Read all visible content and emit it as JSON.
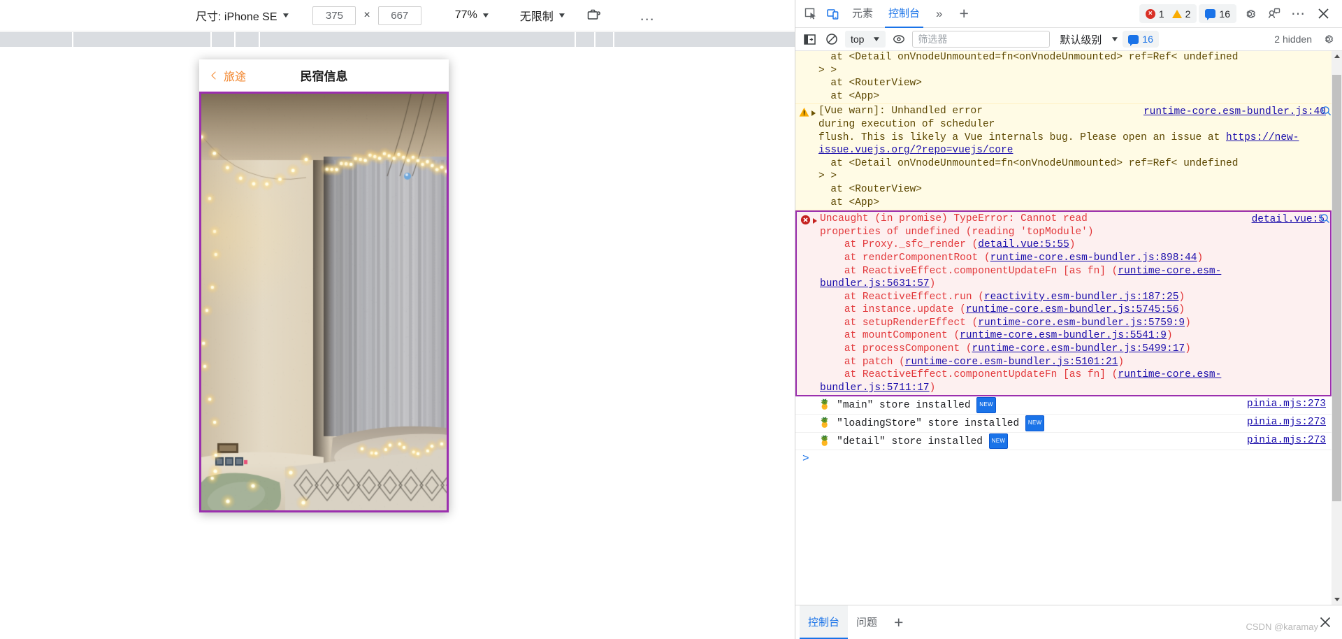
{
  "device_toolbar": {
    "size_label": "尺寸: iPhone SE",
    "width_value": "375",
    "times": "×",
    "height_value": "667",
    "zoom_label": "77%",
    "throttle_label": "无限制",
    "screenshot_icon": "camera-rotate-icon",
    "more_options": "…"
  },
  "mobile_app": {
    "back_label": "旅途",
    "title": "民宿信息",
    "hero_image_alt": "bedroom-with-fairy-lights-photo"
  },
  "devtools": {
    "tabs": [
      {
        "label": "元素",
        "active": false
      },
      {
        "label": "控制台",
        "active": true
      }
    ],
    "more_tabs_icon": "double-chevron-right-icon",
    "add_tab_icon": "plus-icon",
    "inspect_icon": "inspect-cursor-icon",
    "device_toggle_icon": "device-toolbar-icon",
    "settings_icon": "gear-icon",
    "feedback_icon": "feedback-icon",
    "more_icon": "three-dots-icon",
    "close_icon": "close-icon",
    "counters": {
      "errors": "1",
      "warnings": "2",
      "messages": "16"
    }
  },
  "console_toolbar": {
    "sidebar_icon": "console-sidebar-icon",
    "clear_icon": "clear-console-icon",
    "context": "top",
    "eye_icon": "live-expression-icon",
    "filter_placeholder": "筛选器",
    "filter_value": "",
    "level": "默认级别",
    "issues_count": "16",
    "hidden_label": "2 hidden",
    "settings_icon": "gear-icon"
  },
  "console_messages": [
    {
      "id": "warn-partial",
      "severity": "warn",
      "partial": true,
      "lines": [
        "  at <Detail onVnodeUnmounted=fn<onVnodeUnmounted> ref=Ref< undefined",
        "> >",
        "  at <RouterView>",
        "  at <App>"
      ],
      "dim_word": "undefined",
      "source": ""
    },
    {
      "id": "vue-warn-unhandled",
      "severity": "warn",
      "text_head": "[Vue warn]: Unhandled error",
      "text_body": "during execution of scheduler\nflush. This is likely a Vue internals bug. Please open an issue at ",
      "link_text": "https://new-issue.vuejs.org/?repo=vuejs/core",
      "stack": [
        "  at <Detail onVnodeUnmounted=fn<onVnodeUnmounted> ref=Ref< undefined",
        "> >",
        "  at <RouterView>",
        "  at <App>"
      ],
      "source": "runtime-core.esm-bundler.js:40"
    },
    {
      "id": "uncaught-typeerror",
      "severity": "error",
      "highlighted": true,
      "text_head": "Uncaught (in promise) TypeError: Cannot read",
      "text_body": "properties of undefined (reading 'topModule')",
      "source": "detail.vue:5",
      "stack": [
        {
          "fn": "    at Proxy._sfc_render (",
          "link": "detail.vue:5:55",
          "tail": ")"
        },
        {
          "fn": "    at renderComponentRoot (",
          "link": "runtime-core.esm-bundler.js:898:44",
          "tail": ")"
        },
        {
          "fn": "    at ReactiveEffect.componentUpdateFn [as fn] (",
          "link": "runtime-core.esm-bundler.js:5631:57",
          "tail": ")"
        },
        {
          "fn": "    at ReactiveEffect.run (",
          "link": "reactivity.esm-bundler.js:187:25",
          "tail": ")"
        },
        {
          "fn": "    at instance.update (",
          "link": "runtime-core.esm-bundler.js:5745:56",
          "tail": ")"
        },
        {
          "fn": "    at setupRenderEffect (",
          "link": "runtime-core.esm-bundler.js:5759:9",
          "tail": ")"
        },
        {
          "fn": "    at mountComponent (",
          "link": "runtime-core.esm-bundler.js:5541:9",
          "tail": ")"
        },
        {
          "fn": "    at processComponent (",
          "link": "runtime-core.esm-bundler.js:5499:17",
          "tail": ")"
        },
        {
          "fn": "    at patch (",
          "link": "runtime-core.esm-bundler.js:5101:21",
          "tail": ")"
        },
        {
          "fn": "    at ReactiveEffect.componentUpdateFn [as fn] (",
          "link": "runtime-core.esm-bundler.js:5711:17",
          "tail": ")"
        }
      ]
    },
    {
      "id": "pinia-main",
      "severity": "log",
      "icon": "pineapple-icon",
      "text": "\"main\" store installed",
      "badge": "NEW",
      "source": "pinia.mjs:273"
    },
    {
      "id": "pinia-loadingStore",
      "severity": "log",
      "icon": "pineapple-icon",
      "text": "\"loadingStore\" store installed",
      "badge": "NEW",
      "source": "pinia.mjs:273"
    },
    {
      "id": "pinia-detail",
      "severity": "log",
      "icon": "pineapple-icon",
      "text": "\"detail\" store installed",
      "badge": "NEW",
      "source": "pinia.mjs:273"
    }
  ],
  "console_prompt": ">",
  "drawer": {
    "tabs": [
      {
        "label": "控制台",
        "active": true
      },
      {
        "label": "问题",
        "active": false
      }
    ],
    "add_icon": "plus-icon",
    "close_icon": "close-icon"
  },
  "watermark": "CSDN @karamay",
  "colors": {
    "accent_blue": "#1a73e8",
    "error_red": "#d93025",
    "warn_yellow": "#f9ab00",
    "highlight_purple": "#9b2fae",
    "app_orange": "#f2852c",
    "link_blue": "#1a0dab"
  }
}
